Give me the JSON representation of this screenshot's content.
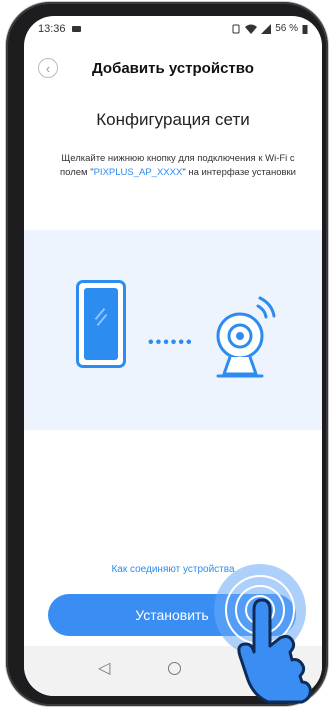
{
  "status_bar": {
    "time": "13:36",
    "battery": "56 %"
  },
  "header": {
    "title": "Добавить устройство",
    "back_icon": "chevron-left-icon"
  },
  "content": {
    "subtitle": "Конфигурация сети",
    "desc_prefix": "Щелкайте нижнюю кнопку для подключения к Wi-Fi с полем \"",
    "desc_accent": "PIXPLUS_AP_XXXX",
    "desc_suffix": "\" на интерфазе установки",
    "dots": "••••••"
  },
  "link": "Как соединяют устройства",
  "button": "Установить",
  "colors": {
    "accent": "#2d8cf0",
    "button": "#3a8ef3",
    "illustration_bg": "#eef4fd"
  }
}
